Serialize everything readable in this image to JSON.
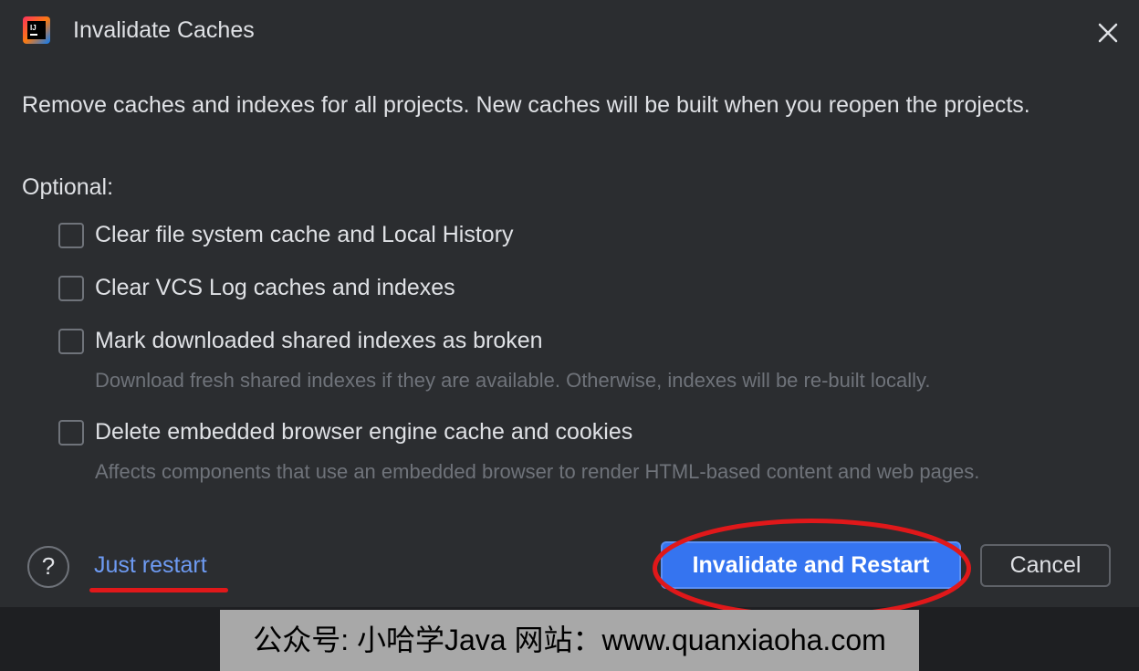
{
  "window": {
    "title": "Invalidate Caches",
    "app_icon": "intellij-idea-icon",
    "close_icon": "close-icon"
  },
  "description": "Remove caches and indexes for all projects. New caches will be built when you reopen the projects.",
  "optional_label": "Optional:",
  "options": [
    {
      "label": "Clear file system cache and Local History",
      "checked": false
    },
    {
      "label": "Clear VCS Log caches and indexes",
      "checked": false
    },
    {
      "label": "Mark downloaded shared indexes as broken",
      "checked": false,
      "hint": "Download fresh shared indexes if they are available. Otherwise, indexes will be re-built locally."
    },
    {
      "label": "Delete embedded browser engine cache and cookies",
      "checked": false,
      "hint": "Affects components that use an embedded browser to render HTML-based content and web pages."
    }
  ],
  "footer": {
    "help_label": "?",
    "just_restart": "Just restart",
    "primary": "Invalidate and Restart",
    "cancel": "Cancel"
  },
  "watermark": "公众号: 小哈学Java  网站：www.quanxiaoha.com",
  "colors": {
    "dialog_bg": "#2b2d30",
    "primary_button": "#3574f0",
    "link": "#6e9bf3",
    "hint_text": "#6f737a",
    "annotation_red": "#e0181a"
  }
}
